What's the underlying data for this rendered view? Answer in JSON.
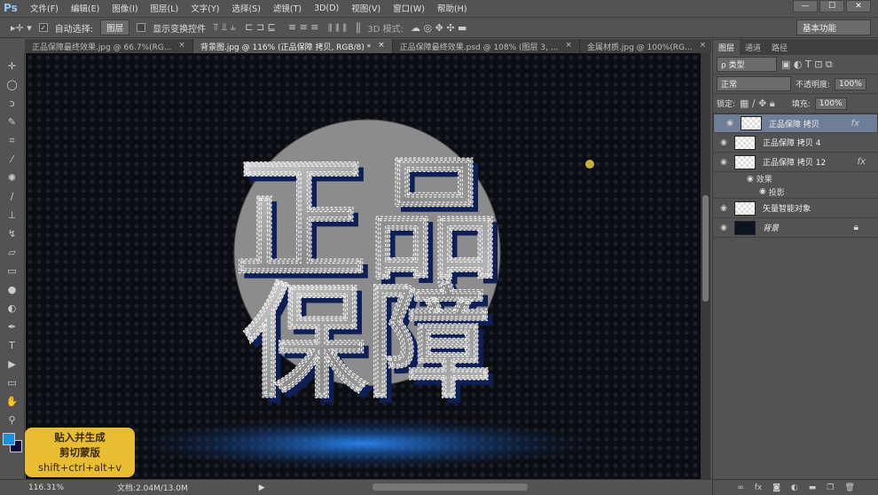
{
  "app": {
    "logo": "Ps",
    "window_controls": [
      "—",
      "☐",
      "✕"
    ]
  },
  "menu": [
    "文件(F)",
    "编辑(E)",
    "图像(I)",
    "图层(L)",
    "文字(Y)",
    "选择(S)",
    "滤镜(T)",
    "3D(D)",
    "视图(V)",
    "窗口(W)",
    "帮助(H)"
  ],
  "options": {
    "auto_select_label": "自动选择:",
    "auto_select_value": "图层",
    "show_transform_label": "显示变换控件",
    "mode_3d_label": "3D 模式:",
    "workspace": "基本功能"
  },
  "tabs": [
    {
      "label": "正品保障最终效果.jpg @ 66.7%(RG...",
      "active": false
    },
    {
      "label": "背景图.jpg @ 116% (正品保障 拷贝, RGB/8) *",
      "active": true
    },
    {
      "label": "正品保障最终效果.psd @ 108% (图层 3, ...",
      "active": false
    },
    {
      "label": "金属材质.jpg @ 100%(RG...",
      "active": false
    }
  ],
  "canvas": {
    "line1": "正品",
    "line2": "保障"
  },
  "hint": {
    "line1": "贴入并生成",
    "line2": "剪切蒙版",
    "line3": "shift+ctrl+alt+v"
  },
  "status": {
    "zoom": "116.31%",
    "doc": "文档:2.04M/13.0M"
  },
  "panel": {
    "tabs": [
      "图层",
      "通道",
      "路径"
    ],
    "filter": "ρ 类型",
    "blend_mode": "正常",
    "opacity_label": "不透明度:",
    "opacity": "100%",
    "lock_label": "锁定:",
    "fill_label": "填充:",
    "fill": "100%",
    "layers": [
      {
        "name": "正品保障 拷贝",
        "fx": "fx",
        "selected": true
      },
      {
        "name": "正品保障 拷贝 4",
        "fx": "",
        "selected": false
      },
      {
        "name": "正品保障 拷贝 12",
        "fx": "fx",
        "selected": false
      },
      {
        "name": "矢量智能对象",
        "fx": "",
        "selected": false
      },
      {
        "name": "背景",
        "fx": "",
        "selected": false
      }
    ],
    "effects_label": "效果",
    "shadow_label": "投影"
  },
  "colors": {
    "foreground": "#1e8fd8",
    "background": "#0a0a40",
    "hint_bg": "#e8bd32"
  }
}
